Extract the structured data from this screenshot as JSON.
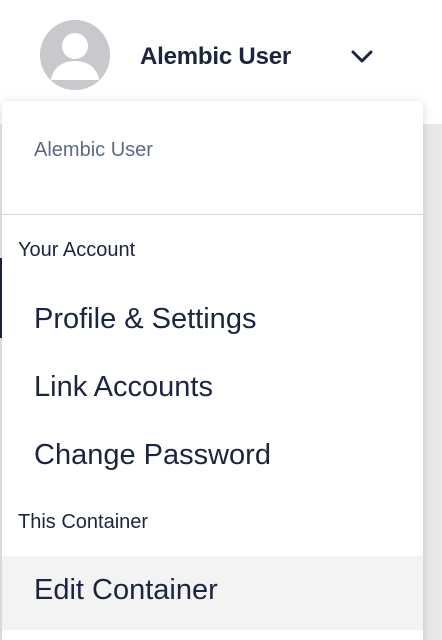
{
  "header": {
    "user_name": "Alembic User",
    "avatar_icon": "user-avatar-icon",
    "toggle_icon": "chevron-down-icon"
  },
  "dropdown": {
    "user_name": "Alembic User",
    "sections": [
      {
        "label": "Your Account",
        "items": [
          "Profile & Settings",
          "Link Accounts",
          "Change Password"
        ]
      },
      {
        "label": "This Container",
        "items": [
          "Edit Container"
        ]
      }
    ]
  },
  "colors": {
    "text_primary": "#1b2540",
    "text_muted": "#5b6b84",
    "avatar_bg": "#c7c9cd",
    "highlight_bg": "#f3f3f4"
  }
}
